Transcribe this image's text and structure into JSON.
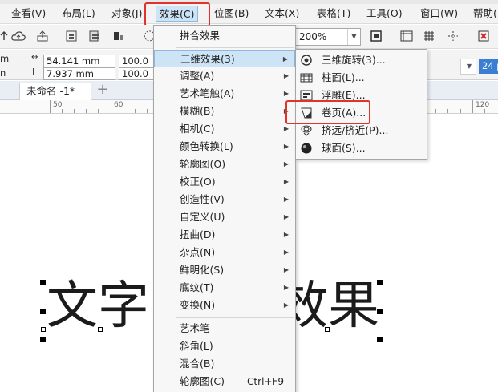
{
  "menubar": {
    "items": [
      "查看(V)",
      "布局(L)",
      "对象(J)",
      "效果(C)",
      "位图(B)",
      "文本(X)",
      "表格(T)",
      "工具(O)",
      "窗口(W)",
      "帮助("
    ]
  },
  "toolbar": {
    "zoom": "200%",
    "width": "54.141 mm",
    "height": "7.937 mm",
    "scale_x": "100.0",
    "scale_y": "100.0",
    "font_size": "24 p",
    "left_x": "m",
    "left_y": "n"
  },
  "tabs": {
    "doc": "未命名 -1*",
    "new": "+"
  },
  "ruler": {
    "labels": [
      "50",
      "60",
      "120"
    ]
  },
  "canvas": {
    "text_left": "文字",
    "text_right": "效果"
  },
  "effects_menu": {
    "items": [
      {
        "label": "拼合效果",
        "submenu": false
      },
      {
        "label": "三维效果(3)",
        "submenu": true
      },
      {
        "label": "调整(A)",
        "submenu": true
      },
      {
        "label": "艺术笔触(A)",
        "submenu": true
      },
      {
        "label": "模糊(B)",
        "submenu": true
      },
      {
        "label": "相机(C)",
        "submenu": true
      },
      {
        "label": "颜色转换(L)",
        "submenu": true
      },
      {
        "label": "轮廓图(O)",
        "submenu": true
      },
      {
        "label": "校正(O)",
        "submenu": true
      },
      {
        "label": "创造性(V)",
        "submenu": true
      },
      {
        "label": "自定义(U)",
        "submenu": true
      },
      {
        "label": "扭曲(D)",
        "submenu": true
      },
      {
        "label": "杂点(N)",
        "submenu": true
      },
      {
        "label": "鲜明化(S)",
        "submenu": true
      },
      {
        "label": "底纹(T)",
        "submenu": true
      },
      {
        "label": "变换(N)",
        "submenu": true
      },
      {
        "label": "艺术笔",
        "submenu": false
      },
      {
        "label": "斜角(L)",
        "submenu": false
      },
      {
        "label": "混合(B)",
        "submenu": false
      },
      {
        "label": "轮廓图(C)",
        "submenu": false,
        "shortcut": "Ctrl+F9"
      }
    ]
  },
  "submenu_3d": {
    "items": [
      {
        "label": "三维旋转(3)...",
        "icon": "3d-rotate-icon"
      },
      {
        "label": "柱面(L)...",
        "icon": "cylinder-icon"
      },
      {
        "label": "浮雕(E)...",
        "icon": "emboss-icon"
      },
      {
        "label": "卷页(A)...",
        "icon": "page-curl-icon"
      },
      {
        "label": "挤远/挤近(P)...",
        "icon": "pinch-punch-icon"
      },
      {
        "label": "球面(S)...",
        "icon": "sphere-icon"
      }
    ]
  },
  "colors": {
    "highlight": "#cde3f6",
    "annotation_red": "#e0332c"
  }
}
